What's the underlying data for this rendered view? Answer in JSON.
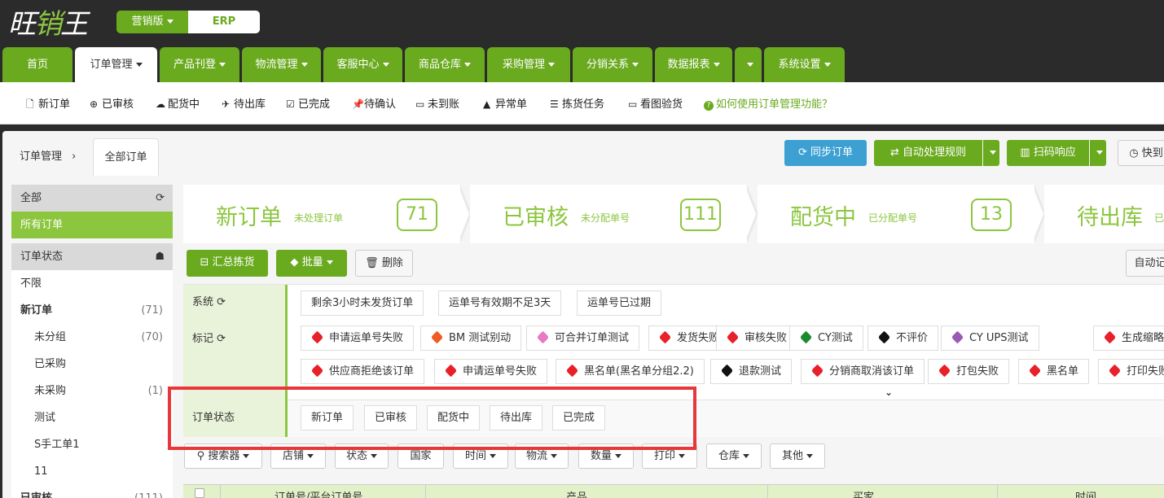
{
  "brand": {
    "logo_a": "旺",
    "logo_b": "销",
    "logo_c": "王",
    "edition": "营销版",
    "product": "ERP"
  },
  "main_nav": [
    {
      "label": "首页",
      "caret": false
    },
    {
      "label": "订单管理",
      "caret": true,
      "active": true
    },
    {
      "label": "产品刊登",
      "caret": true
    },
    {
      "label": "物流管理",
      "caret": true
    },
    {
      "label": "客服中心",
      "caret": true
    },
    {
      "label": "商品仓库",
      "caret": true
    },
    {
      "label": "采购管理",
      "caret": true
    },
    {
      "label": "分销关系",
      "caret": true
    },
    {
      "label": "数据报表",
      "caret": true
    },
    {
      "label": "",
      "caret": true
    },
    {
      "label": "系统设置",
      "caret": true
    }
  ],
  "sub_nav": [
    {
      "label": "新订单",
      "icon": "file-icon"
    },
    {
      "label": "已审核",
      "icon": "gift-icon"
    },
    {
      "label": "配货中",
      "icon": "cloud-upload-icon"
    },
    {
      "label": "待出库",
      "icon": "plane-icon"
    },
    {
      "label": "已完成",
      "icon": "check-square-icon"
    },
    {
      "label": "待确认",
      "icon": "pin-icon"
    },
    {
      "label": "未到账",
      "icon": "credit-card-icon"
    },
    {
      "label": "异常单",
      "icon": "warning-icon"
    },
    {
      "label": "拣货任务",
      "icon": "list-icon"
    },
    {
      "label": "看图验货",
      "icon": "monitor-icon"
    },
    {
      "label": "如何使用订单管理功能？",
      "icon": "question-icon"
    }
  ],
  "breadcrumb": {
    "root": "订单管理",
    "sep": "›",
    "current": "全部订单"
  },
  "top_buttons": {
    "sync": "同步订单",
    "auto_rule": "自动处理规则",
    "scan": "扫码响应",
    "quick": "快到"
  },
  "sidebar": {
    "all_header": "全部",
    "all_orders": "所有订单",
    "status_header": "订单状态",
    "items": [
      {
        "label": "不限",
        "count": ""
      },
      {
        "label": "新订单",
        "count": "(71)"
      },
      {
        "label": "未分组",
        "count": "(70)"
      },
      {
        "label": "已采购",
        "count": ""
      },
      {
        "label": "未采购",
        "count": "(1)"
      },
      {
        "label": "测试",
        "count": ""
      },
      {
        "label": "S手工单1",
        "count": ""
      },
      {
        "label": "11",
        "count": ""
      },
      {
        "label": "已审核",
        "count": "(111)"
      }
    ]
  },
  "steps": [
    {
      "title": "新订单",
      "sub": "未处理订单",
      "count": "71"
    },
    {
      "title": "已审核",
      "sub": "未分配单号",
      "count": "111"
    },
    {
      "title": "配货中",
      "sub": "已分配单号",
      "count": "13"
    },
    {
      "title": "待出库",
      "sub": "已",
      "count": ""
    }
  ],
  "action_buttons": {
    "summary": "汇总拣货",
    "batch": "批量",
    "delete": "删除",
    "auto": "自动记"
  },
  "filters": {
    "system_label": "系统",
    "system_tags": [
      "剩余3小时未发货订单",
      "运单号有效期不足3天",
      "运单号已过期"
    ],
    "mark_label": "标记",
    "mark_tags_row1": [
      {
        "label": "申请运单号失败",
        "color": "#e8202a"
      },
      {
        "label": "BM 测试别动",
        "color": "#f05a24"
      },
      {
        "label": "可合并订单测试",
        "color": "#e879c4"
      },
      {
        "label": "发货失败",
        "color": "#e8202a"
      },
      {
        "label": "审核失败",
        "color": "#e8202a"
      },
      {
        "label": "CY测试",
        "color": "#1b8a2e"
      },
      {
        "label": "不评价",
        "color": "#111111"
      },
      {
        "label": "CY UPS测试",
        "color": "#9b59b6"
      },
      {
        "label": "生成缩略图",
        "color": "#e8202a"
      }
    ],
    "mark_tags_row2": [
      {
        "label": "供应商拒绝该订单",
        "color": "#e8202a"
      },
      {
        "label": "申请运单号失败",
        "color": "#e8202a"
      },
      {
        "label": "黑名单(黑名单分组2.2)",
        "color": "#e8202a"
      },
      {
        "label": "退款测试",
        "color": "#111111"
      },
      {
        "label": "分销商取消该订单",
        "color": "#e8202a"
      },
      {
        "label": "打包失败",
        "color": "#e8202a"
      },
      {
        "label": "黑名单",
        "color": "#e8202a"
      },
      {
        "label": "打印失败",
        "color": "#e8202a"
      }
    ],
    "expand": "⌄",
    "status_label": "订单状态",
    "status_tags": [
      "新订单",
      "已审核",
      "配货中",
      "待出库",
      "已完成"
    ]
  },
  "toolbar": [
    "搜索器",
    "店铺",
    "状态",
    "国家",
    "时间",
    "物流",
    "数量",
    "打印",
    "仓库",
    "其他"
  ],
  "table_header": [
    "订单号/平台订单号",
    "产品",
    "买家",
    "时间"
  ],
  "colors": {
    "accent": "#6aaa1e",
    "accent_light": "#8cc63f",
    "blue": "#3ca0d2",
    "highlight": "#e8373b"
  }
}
